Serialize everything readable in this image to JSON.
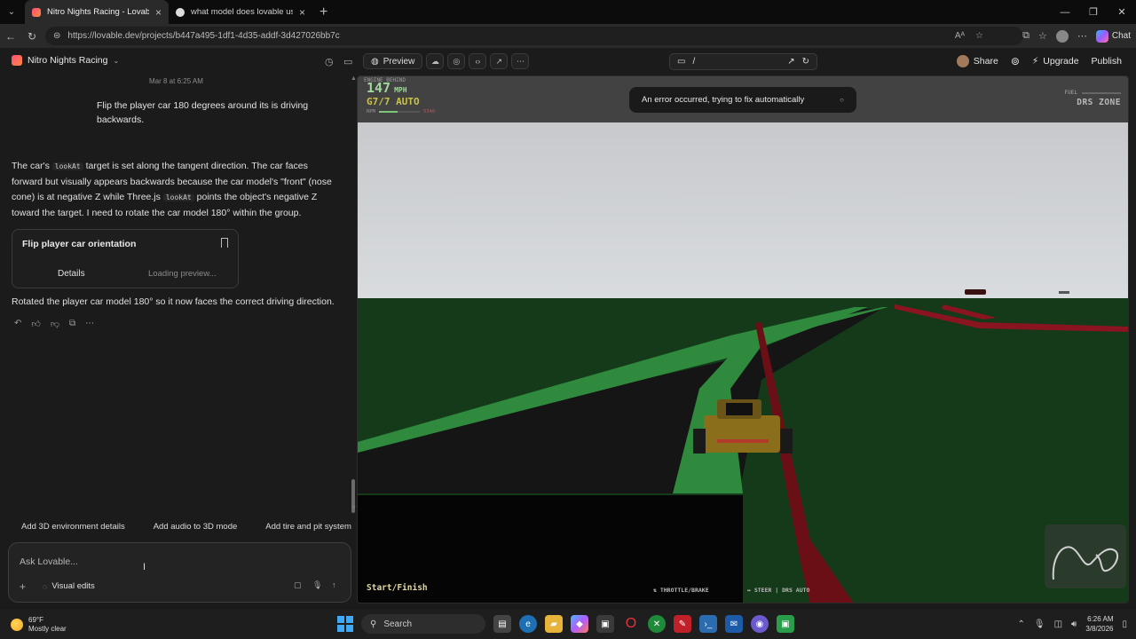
{
  "browser": {
    "tabs": [
      {
        "title": "Nitro Nights Racing - Lovable",
        "active": true
      },
      {
        "title": "what model does lovable use - Go",
        "active": false
      }
    ],
    "url": "https://lovable.dev/projects/b447a495-1df1-4d35-addf-3d427026bb7c",
    "chat_button": "Chat"
  },
  "header": {
    "project_name": "Nitro Nights Racing",
    "preview_label": "Preview",
    "path": "/",
    "share_label": "Share",
    "upgrade_label": "Upgrade",
    "publish_label": "Publish"
  },
  "chat": {
    "timestamp": "Mar 8 at 6:25 AM",
    "user_message": "Flip the player car 180 degrees around its is driving backwards.",
    "ai_message": {
      "p1": "The car's",
      "code1": "lookAt",
      "p2": "target is set along the tangent direction. The car faces forward but visually appears backwards because the car model's \"front\" (nose cone) is at negative Z while Three.js",
      "code2": "lookAt",
      "p3": "points the object's negative Z toward the target. I need to rotate the car model 180° within the group."
    },
    "card": {
      "title": "Flip player car orientation",
      "details": "Details",
      "loading": "Loading preview..."
    },
    "result": "Rotated the player car model 180° so it now faces the correct driving direction.",
    "suggestions": [
      "Add 3D environment details",
      "Add audio to 3D mode",
      "Add tire and pit system"
    ],
    "input_placeholder": "Ask Lovable...",
    "visual_edits": "Visual edits"
  },
  "game": {
    "engine_label": "ENGINE BEHIND",
    "speed": "147",
    "speed_unit": "MPH",
    "gear": "G7/7 AUTO",
    "rpm_label": "RPM",
    "rpm_value": "5340",
    "rpm_fraction": 0.45,
    "fuel_label": "FUEL",
    "drs": "DRS ZONE",
    "toast": "An error occurred, trying to fix automatically",
    "location": "Start/Finish",
    "control1": "⇅ THROTTLE/BRAKE",
    "control2": "↔ STEER | DRS AUTO"
  },
  "taskbar": {
    "temp": "69°F",
    "condition": "Mostly clear",
    "search": "Search",
    "time": "6:26 AM",
    "date": "3/8/2026"
  }
}
